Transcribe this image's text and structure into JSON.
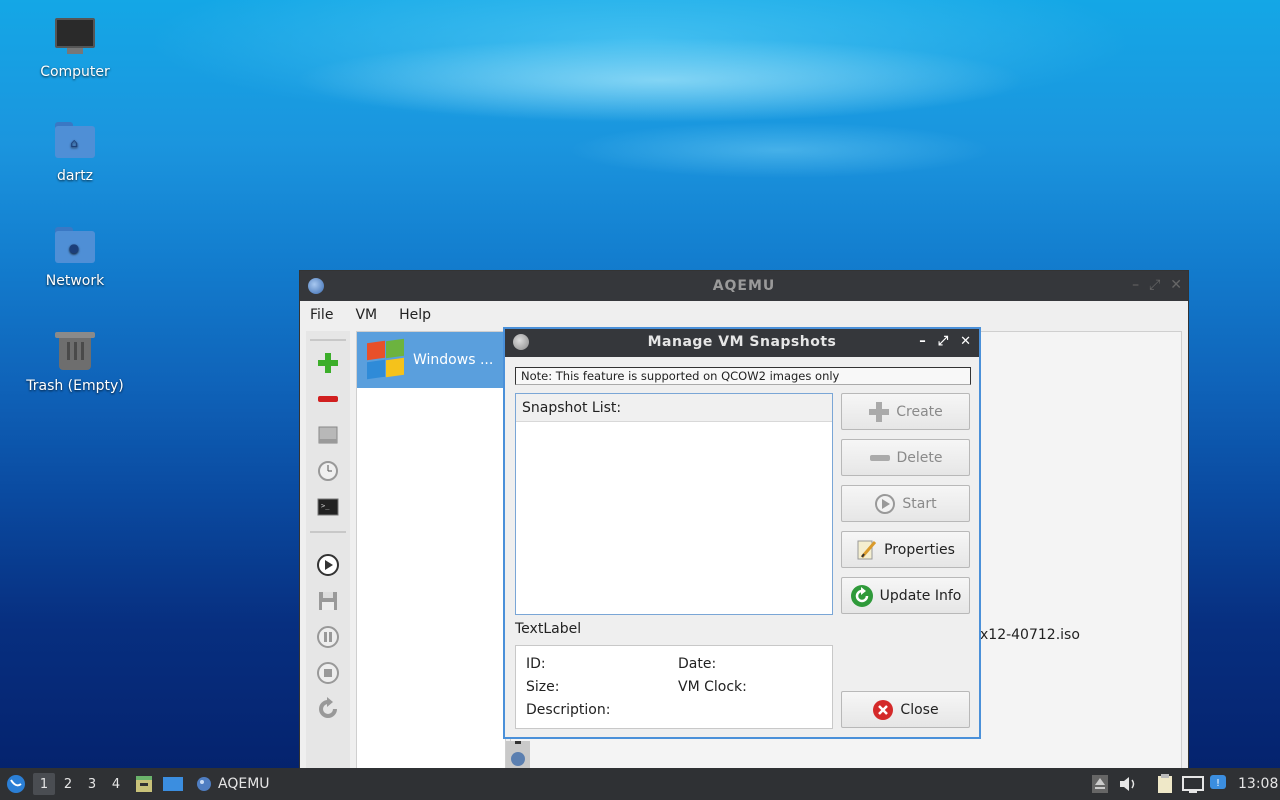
{
  "desktop": {
    "icons": [
      {
        "label": "Computer",
        "icon": "computer-icon"
      },
      {
        "label": "dartz",
        "icon": "home-folder-icon"
      },
      {
        "label": "Network",
        "icon": "network-folder-icon"
      },
      {
        "label": "Trash (Empty)",
        "icon": "trash-icon"
      }
    ]
  },
  "main_window": {
    "title": "AQEMU",
    "menu": [
      "File",
      "VM",
      "Help"
    ],
    "toolbar_icons": [
      "add-vm-icon",
      "remove-vm-icon",
      "hdd-icon",
      "clock-icon",
      "terminal-icon",
      "play-icon",
      "save-icon",
      "pause-icon",
      "stop-icon",
      "reset-icon"
    ],
    "vm_list": [
      {
        "name": "Windows ...",
        "icon": "windows-xp-icon"
      }
    ],
    "iso_text": "x12-40712.iso"
  },
  "dialog": {
    "title": "Manage VM Snapshots",
    "note": "Note: This feature is supported on QCOW2 images only",
    "snapshot_list_header": "Snapshot List:",
    "buttons": {
      "create": "Create",
      "delete": "Delete",
      "start": "Start",
      "properties": "Properties",
      "update": "Update Info",
      "close": "Close"
    },
    "text_label": "TextLabel",
    "info": {
      "id": "ID:",
      "size": "Size:",
      "description": "Description:",
      "date": "Date:",
      "vm_clock": "VM Clock:"
    }
  },
  "taskbar": {
    "workspaces": [
      "1",
      "2",
      "3",
      "4"
    ],
    "active_workspace": "1",
    "app_label": "AQEMU",
    "clock": "13:08"
  }
}
